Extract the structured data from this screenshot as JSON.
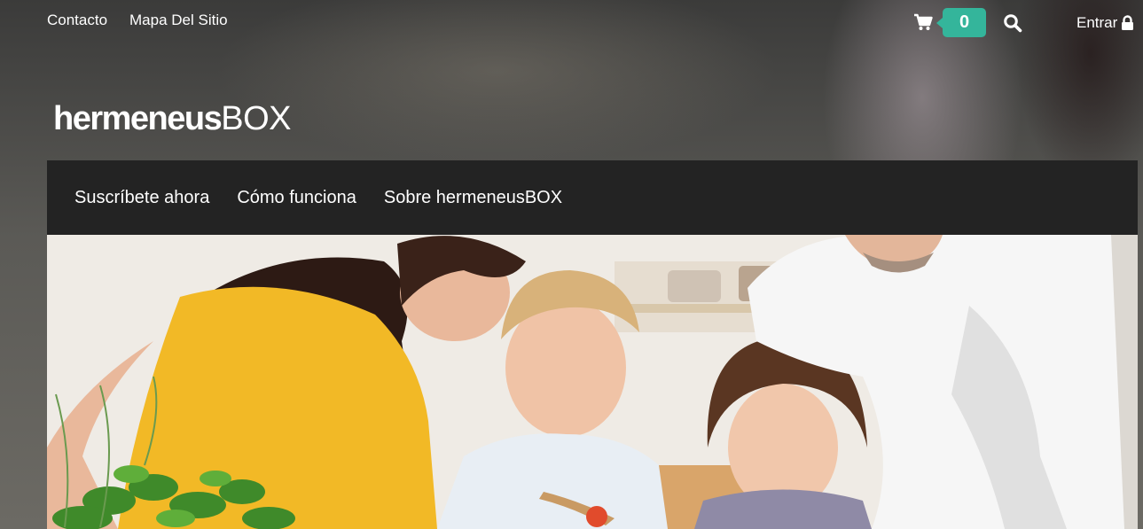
{
  "topbar": {
    "links": [
      {
        "label": "Contacto"
      },
      {
        "label": "Mapa Del Sitio"
      }
    ],
    "cart": {
      "icon": "shopping-cart-icon",
      "count": "0",
      "badge_color": "#34b59b"
    },
    "search": {
      "icon": "search-icon"
    },
    "login": {
      "label": "Entrar",
      "icon": "lock-icon"
    }
  },
  "brand": {
    "name_bold": "hermeneus",
    "name_light": "BOX"
  },
  "nav": {
    "items": [
      {
        "label": "Suscríbete ahora"
      },
      {
        "label": "Cómo funciona"
      },
      {
        "label": "Sobre hermeneusBOX"
      }
    ],
    "background": "#232323"
  },
  "hero": {
    "image": "family-cooking-photo"
  }
}
